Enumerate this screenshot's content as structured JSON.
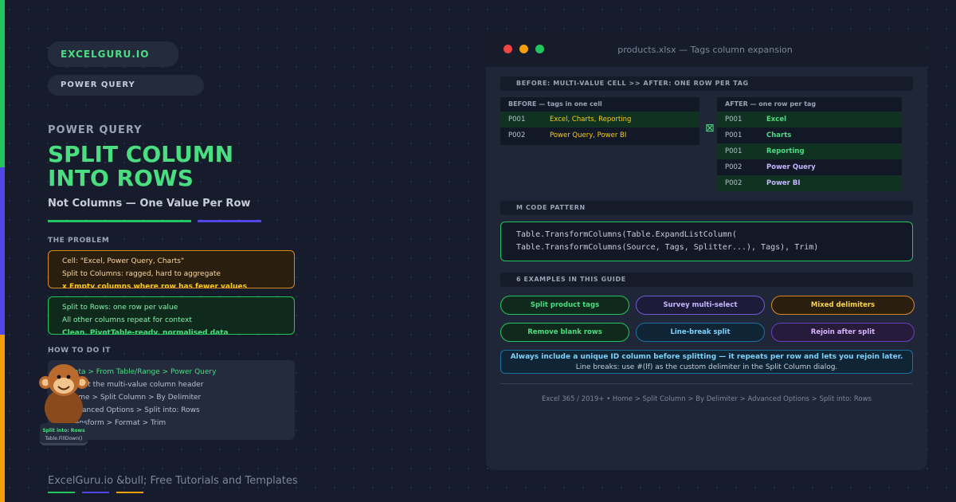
{
  "left": {
    "brand_pill": "EXCELGURU.IO",
    "category_pill": "POWER QUERY",
    "eyebrow": "POWER QUERY",
    "title_line1": "SPLIT COLUMN",
    "title_line2": "INTO ROWS",
    "subtitle": "Not Columns — One Value Per Row",
    "problem_label": "THE PROBLEM",
    "problem_lines": [
      "Cell: \"Excel, Power Query, Charts\"",
      "Split to Columns: ragged, hard to aggregate",
      "x Empty columns where row has fewer values"
    ],
    "solution_lines": [
      "Split to Rows: one row per value",
      "All other columns repeat for context",
      "Clean, PivotTable-ready, normalised data"
    ],
    "howto_label": "HOW TO DO IT",
    "howto_lines": [
      "Data > From Table/Range > Power Query",
      "Select the multi-value column header",
      "Home > Split Column > By Delimiter",
      "Advanced Options > Split into: Rows",
      "Transform > Format > Trim"
    ],
    "mascot_caption_1": "Split into: Rows",
    "mascot_caption_2": "Table.FillDown()",
    "footer": "ExcelGuru.io &bull; Free Tutorials and Templates"
  },
  "window": {
    "title": "products.xlsx — Tags column expansion",
    "section1": "BEFORE: MULTI-VALUE CELL >> AFTER: ONE ROW PER TAG",
    "before_header": "BEFORE — tags in one cell",
    "before_rows": [
      {
        "id": "P001",
        "tags": "Excel, Charts, Reporting"
      },
      {
        "id": "P002",
        "tags": "Power Query, Power BI"
      }
    ],
    "arrow_glyph": "⊠",
    "after_header": "AFTER — one row per tag",
    "after_rows": [
      {
        "id": "P001",
        "tag": "Excel"
      },
      {
        "id": "P001",
        "tag": "Charts"
      },
      {
        "id": "P001",
        "tag": "Reporting"
      },
      {
        "id": "P002",
        "tag": "Power Query"
      },
      {
        "id": "P002",
        "tag": "Power BI"
      }
    ],
    "section2": "M CODE PATTERN",
    "code_line1": "Table.TransformColumns(Table.ExpandListColumn(",
    "code_line2": "Table.TransformColumns(Source, Tags, Splitter...), Tags), Trim)",
    "section3": "6 EXAMPLES IN THIS GUIDE",
    "examples": [
      "Split product tags",
      "Survey multi-select",
      "Mixed delimiters",
      "Remove blank rows",
      "Line-break split",
      "Rejoin after split"
    ],
    "tip_line1": "Always include a unique ID column before splitting — it repeats per row and lets you rejoin later.",
    "tip_line2": "Line breaks: use #(lf) as the custom delimiter in the Split Column dialog.",
    "footer": "Excel 365 / 2019+ • Home > Split Column > By Delimiter > Advanced Options > Split into: Rows"
  },
  "colors": {
    "green": "#4ade80",
    "purple": "#4f46e5",
    "orange": "#f59e0b",
    "blue": "#38bdf8",
    "background": "#161c2c"
  }
}
